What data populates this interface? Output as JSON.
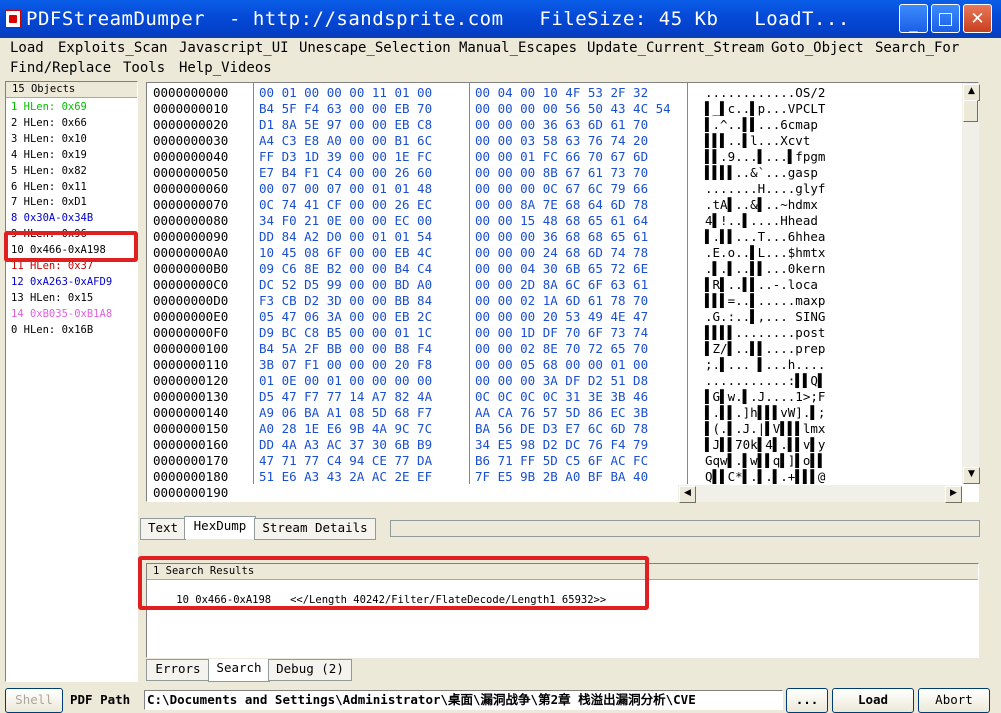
{
  "window": {
    "title": "PDFStreamDumper  - http://sandsprite.com   FileSize: 45 Kb   LoadT...",
    "min_glyph": "_",
    "max_glyph": "□",
    "close_glyph": "✕"
  },
  "menu": {
    "row1": [
      "Load",
      "Exploits_Scan",
      "Javascript_UI",
      "Unescape_Selection",
      "Manual_Escapes",
      "Update_Current_Stream",
      "Goto_Object",
      "Search_For"
    ],
    "row2": [
      "Find/Replace",
      "Tools",
      "Help_Videos"
    ]
  },
  "objects": {
    "header": "15 Objects",
    "items": [
      {
        "text": "1 HLen: 0x69",
        "color": "#00c000"
      },
      {
        "text": "2 HLen: 0x66",
        "color": "#000000"
      },
      {
        "text": "3 HLen: 0x10",
        "color": "#000000"
      },
      {
        "text": "4 HLen: 0x19",
        "color": "#000000"
      },
      {
        "text": "5 HLen: 0x82",
        "color": "#000000"
      },
      {
        "text": "6 HLen: 0x11",
        "color": "#000000"
      },
      {
        "text": "7 HLen: 0xD1",
        "color": "#000000"
      },
      {
        "text": "8 0x30A-0x34B",
        "color": "#0000cc"
      },
      {
        "text": "9 HLen: 0x96",
        "color": "#000000"
      },
      {
        "text": "10 0x466-0xA198",
        "color": "#000000"
      },
      {
        "text": "11 HLen: 0x37",
        "color": "#cc0000"
      },
      {
        "text": "12 0xA263-0xAFD9",
        "color": "#0000cc"
      },
      {
        "text": "13 HLen: 0x15",
        "color": "#000000"
      },
      {
        "text": "14 0xB035-0xB1A8",
        "color": "#e060e0"
      },
      {
        "text": "0 HLen: 0x16B",
        "color": "#000000"
      }
    ]
  },
  "hexdump": {
    "rows": [
      {
        "off": "0000000000",
        "h1": "00 01 00 00 00 11 01 00",
        "h2": "00 04 00 10 4F 53 2F 32",
        "asc": "............OS/2"
      },
      {
        "off": "0000000010",
        "h1": "B4 5F F4 63 00 00 EB 70",
        "h2": "00 00 00 00 56 50 43 4C 54",
        "asc": "▌_▌c..▌p...VPCLT"
      },
      {
        "off": "0000000020",
        "h1": "D1 8A 5E 97 00 00 EB C8",
        "h2": "00 00 00 36 63 6D 61 70",
        "asc": "▌.^..▌▌...6cmap"
      },
      {
        "off": "0000000030",
        "h1": "A4 C3 E8 A0 00 00 B1 6C",
        "h2": "00 00 03 58 63 76 74 20",
        "asc": "▌▌▌..▌l...Xcvt"
      },
      {
        "off": "0000000040",
        "h1": "FF D3 1D 39 00 00 1E FC",
        "h2": "00 00 01 FC 66 70 67 6D",
        "asc": "▌▌.9...▌...▌fpgm"
      },
      {
        "off": "0000000050",
        "h1": "E7 B4 F1 C4 00 00 26 60",
        "h2": "00 00 00 8B 67 61 73 70",
        "asc": "▌▌▌▌..&`...gasp"
      },
      {
        "off": "0000000060",
        "h1": "00 07 00 07 00 01 01 48",
        "h2": "00 00 00 0C 67 6C 79 66",
        "asc": ".......H....glyf"
      },
      {
        "off": "0000000070",
        "h1": "0C 74 41 CF 00 00 26 EC",
        "h2": "00 00 8A 7E 68 64 6D 78",
        "asc": ".tA▌..&▌..~hdmx"
      },
      {
        "off": "0000000080",
        "h1": "34 F0 21 0E 00 00 EC 00",
        "h2": "00 00 15 48 68 65 61 64",
        "asc": "4▌!..▌....Hhead"
      },
      {
        "off": "0000000090",
        "h1": "DD 84 A2 D0 00 01 01 54",
        "h2": "00 00 00 36 68 68 65 61",
        "asc": "▌.▌▌...T...6hhea"
      },
      {
        "off": "00000000A0",
        "h1": "10 45 08 6F 00 00 EB 4C",
        "h2": "00 00 00 24 68 6D 74 78",
        "asc": ".E.o..▌L...$hmtx"
      },
      {
        "off": "00000000B0",
        "h1": "09 C6 8E B2 00 00 B4 C4",
        "h2": "00 00 04 30 6B 65 72 6E",
        "asc": ".▌.▌..▌▌...0kern"
      },
      {
        "off": "00000000C0",
        "h1": "DC 52 D5 99 00 00 BD A0",
        "h2": "00 00 2D 8A 6C 6F 63 61",
        "asc": "▌R▌..▌▌..-.loca"
      },
      {
        "off": "00000000D0",
        "h1": "F3 CB D2 3D 00 00 BB 84",
        "h2": "00 00 02 1A 6D 61 78 70",
        "asc": "▌▌▌=..▌.....maxp"
      },
      {
        "off": "00000000E0",
        "h1": "05 47 06 3A 00 00 EB 2C",
        "h2": "00 00 00 20 53 49 4E 47",
        "asc": ".G.:..▌,... SING"
      },
      {
        "off": "00000000F0",
        "h1": "D9 BC C8 B5 00 00 01 1C",
        "h2": "00 00 1D DF 70 6F 73 74",
        "asc": "▌▌▌▌........post"
      },
      {
        "off": "0000000100",
        "h1": "B4 5A 2F BB 00 00 B8 F4",
        "h2": "00 00 02 8E 70 72 65 70",
        "asc": "▌Z/▌..▌▌....prep"
      },
      {
        "off": "0000000110",
        "h1": "3B 07 F1 00 00 00 20 F8",
        "h2": "00 00 05 68 00 00 01 00",
        "asc": ";.▌... ▌...h...."
      },
      {
        "off": "0000000120",
        "h1": "01 0E 00 01 00 00 00 00",
        "h2": "00 00 00 3A DF D2 51 D8",
        "asc": "...........:▌▌Q▌"
      },
      {
        "off": "0000000130",
        "h1": "D5 47 F7 77 14 A7 82 4A",
        "h2": "0C 0C 0C 0C 31 3E 3B 46",
        "asc": "▌G▌w.▌.J....1>;F"
      },
      {
        "off": "0000000140",
        "h1": "A9 06 BA A1 08 5D 68 F7",
        "h2": "AA CA 76 57 5D 86 EC 3B",
        "asc": "▌.▌▌.]h▌▌▌vW].▌;"
      },
      {
        "off": "0000000150",
        "h1": "A0 28 1E E6 9B 4A 9C 7C",
        "h2": "BA 56 DE D3 E7 6C 6D 78",
        "asc": "▌(.▌.J.|▌V▌▌▌lmx"
      },
      {
        "off": "0000000160",
        "h1": "DD 4A A3 AC 37 30 6B B9",
        "h2": "34 E5 98 D2 DC 76 F4 79",
        "asc": "▌J▌▌70k▌4▌.▌▌v▌y"
      },
      {
        "off": "0000000170",
        "h1": "47 71 77 C4 94 CE 77 DA",
        "h2": "B6 71 FF 5D C5 6F AC FC",
        "asc": "Gqw▌.▌w▌▌q▌]▌o▌▌"
      },
      {
        "off": "0000000180",
        "h1": "51 E6 A3 43 2A AC 2E EF",
        "h2": "7F E5 9B 2B A0 BF BA 40",
        "asc": "Q▌▌C*▌.▌.▌.+▌▌▌@"
      },
      {
        "off": "0000000190",
        "h1": "",
        "h2": "",
        "asc": ""
      }
    ]
  },
  "tabs_top": [
    "Text",
    "HexDump",
    "Stream Details"
  ],
  "search": {
    "header": "1 Search Results",
    "result_obj": "10 0x466-0xA198",
    "result_text": "<</Length 40242/Filter/FlateDecode/Length1 65932>>"
  },
  "tabs_bottom": [
    "Errors",
    "Search",
    "Debug (2)"
  ],
  "statusbar": {
    "shell": "Shell",
    "pdf_path_label": "PDF Path",
    "pdf_path": "C:\\Documents and Settings\\Administrator\\桌面\\漏洞战争\\第2章 栈溢出漏洞分析\\CVE",
    "browse": "...",
    "load": "Load",
    "abort": "Abort"
  }
}
